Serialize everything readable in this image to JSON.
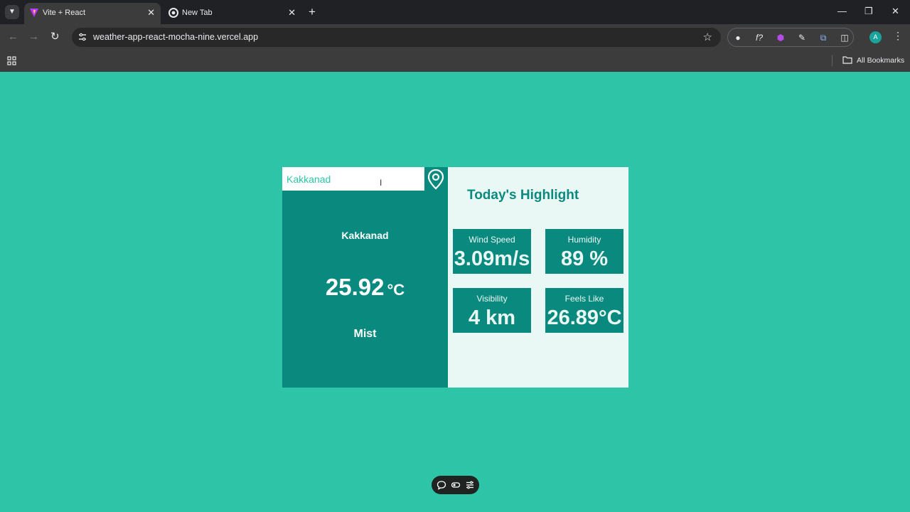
{
  "browser": {
    "tabs": [
      {
        "title": "Vite + React",
        "active": true
      },
      {
        "title": "New Tab",
        "active": false
      }
    ],
    "url": "weather-app-react-mocha-nine.vercel.app",
    "bookmarks_label": "All Bookmarks",
    "profile_initial": "A"
  },
  "weather": {
    "search": {
      "value": "Kakkanad"
    },
    "city": "Kakkanad",
    "temperature": "25.92",
    "unit": "°C",
    "condition": "Mist",
    "highlight_title": "Today's Highlight",
    "highlights": [
      {
        "label": "Wind Speed",
        "value": "3.09m/s"
      },
      {
        "label": "Humidity",
        "value": "89 %"
      },
      {
        "label": "Visibility",
        "value": "4 km"
      },
      {
        "label": "Feels Like",
        "value": "26.89°C"
      }
    ]
  },
  "colors": {
    "page_bg": "#2ec4a8",
    "panel_dark": "#0a8a7e",
    "panel_light": "#e9f8f5"
  }
}
